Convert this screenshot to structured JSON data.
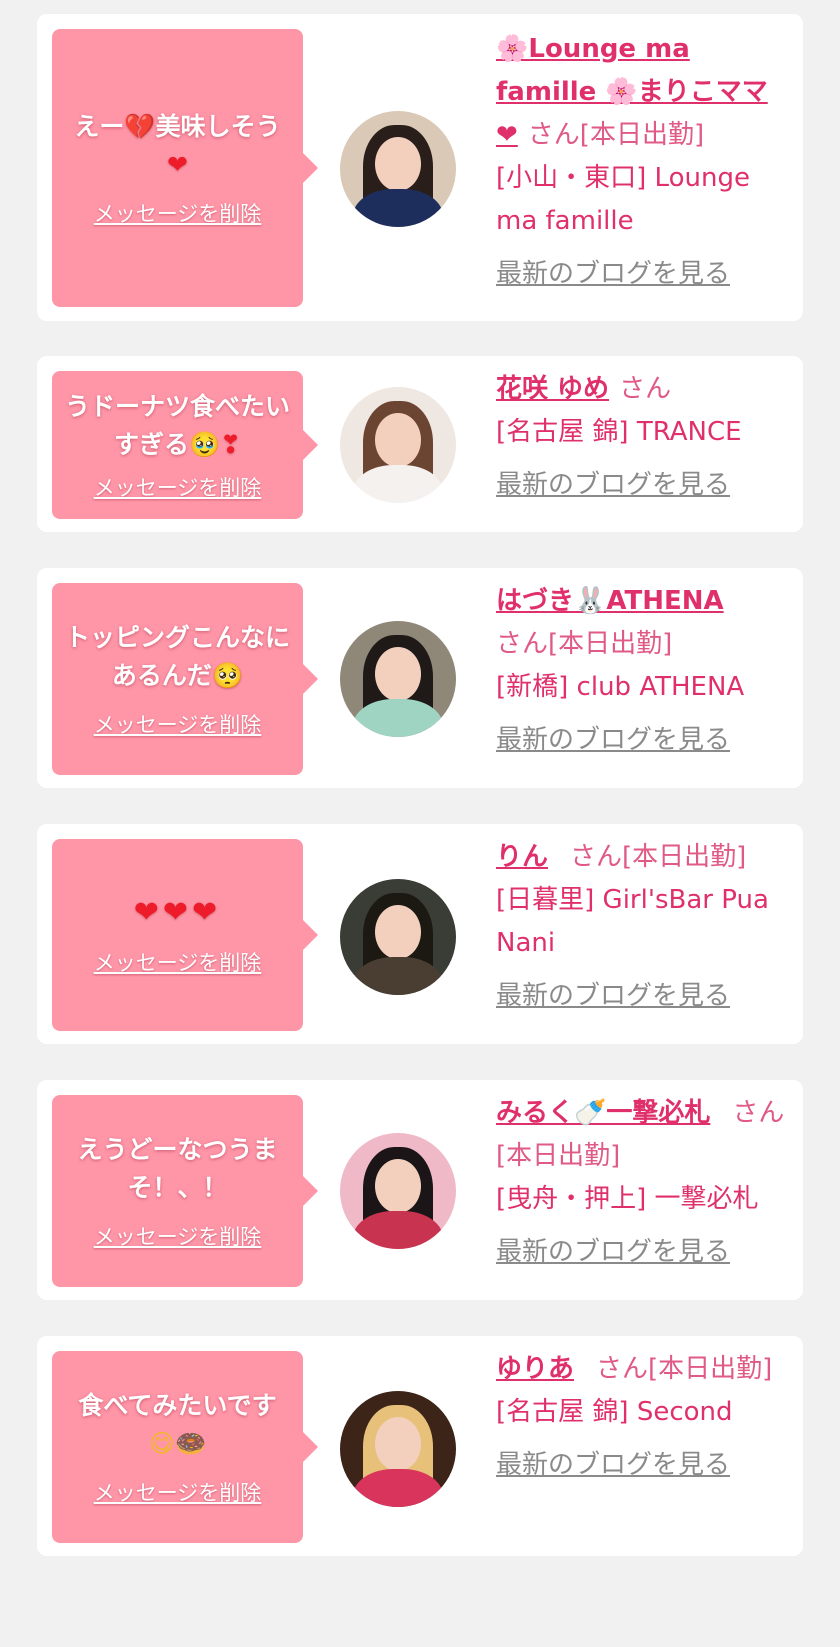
{
  "messages": [
    {
      "bubble_parts": [
        "えー",
        "💔",
        "美味しそう",
        "❤"
      ],
      "delete_label": "メッセージを削除",
      "name": "🌸Lounge ma famille 🌸まりこママ❤",
      "suffix": "さん[本日出勤]",
      "shop": "[小山・東口] Lounge ma famille",
      "blog_label": "最新のブログを見る",
      "avatar_colors": {
        "bg": "#d9c9b6",
        "hair": "#2a1e1a",
        "body": "#1d2e5c"
      }
    },
    {
      "bubble_parts": [
        "うドーナツ食べたいすぎる",
        "🥹",
        "❣"
      ],
      "delete_label": "メッセージを削除",
      "name": "花咲 ゆめ",
      "suffix": "さん",
      "shop": "[名古屋 錦] TRANCE",
      "blog_label": "最新のブログを見る",
      "avatar_colors": {
        "bg": "#efe7e2",
        "hair": "#6b4432",
        "body": "#f4f1ee"
      }
    },
    {
      "bubble_parts": [
        "トッピングこんなにあるんだ",
        "🥺"
      ],
      "delete_label": "メッセージを削除",
      "name": "はづき🐰ATHENA",
      "suffix": "さん[本日出勤]",
      "shop": "[新橋] club ATHENA",
      "blog_label": "最新のブログを見る",
      "avatar_colors": {
        "bg": "#8f8878",
        "hair": "#1f1a18",
        "body": "#9fd4c3"
      }
    },
    {
      "bubble_parts": [
        "❤❤❤"
      ],
      "delete_label": "メッセージを削除",
      "name": "りん",
      "suffix": "さん[本日出勤]",
      "shop": "[日暮里] Girl'sBar Pua Nani",
      "blog_label": "最新のブログを見る",
      "avatar_colors": {
        "bg": "#3a3c36",
        "hair": "#1c1812",
        "body": "#4a3e33"
      }
    },
    {
      "bubble_parts": [
        "えうどーなつうまそ！、！"
      ],
      "delete_label": "メッセージを削除",
      "name": "みるく🍼一撃必札",
      "suffix": "さん[本日出勤]",
      "shop": "[曳舟・押上] 一撃必札",
      "blog_label": "最新のブログを見る",
      "avatar_colors": {
        "bg": "#f0b9c7",
        "hair": "#1b1518",
        "body": "#c8334f"
      }
    },
    {
      "bubble_parts": [
        "食べてみたいです",
        "😋",
        "🍩"
      ],
      "delete_label": "メッセージを削除",
      "name": "ゆりあ",
      "suffix": "さん[本日出勤]",
      "shop": "[名古屋 錦] Second",
      "blog_label": "最新のブログを見る",
      "avatar_colors": {
        "bg": "#3c2418",
        "hair": "#e7c07a",
        "body": "#d8345c"
      }
    }
  ]
}
